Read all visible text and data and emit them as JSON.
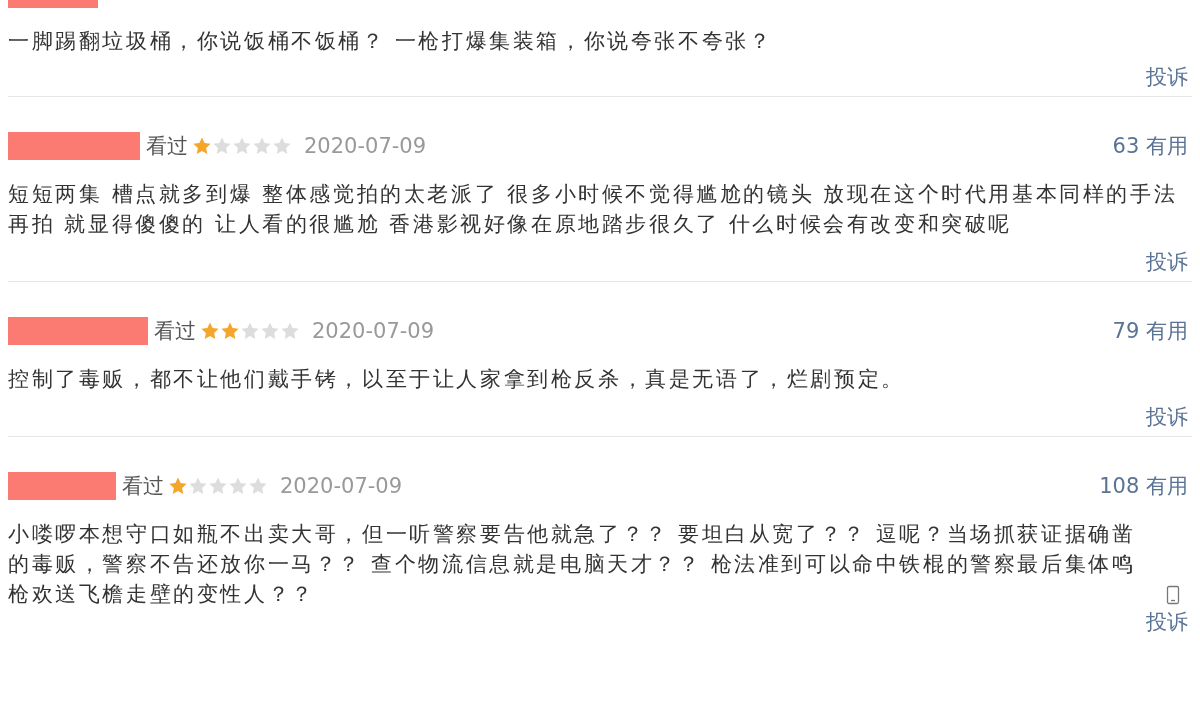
{
  "comments": [
    {
      "text": "一脚踢翻垃圾桶，你说饭桶不饭桶？ 一枪打爆集装箱，你说夸张不夸张？",
      "report": "投诉"
    },
    {
      "status": "看过",
      "stars": 1,
      "date": "2020-07-09",
      "votes": "63 有用",
      "text": "短短两集 槽点就多到爆 整体感觉拍的太老派了 很多小时候不觉得尴尬的镜头 放现在这个时代用基本同样的手法再拍 就显得傻傻的 让人看的很尴尬 香港影视好像在原地踏步很久了 什么时候会有改变和突破呢",
      "report": "投诉"
    },
    {
      "status": "看过",
      "stars": 2,
      "date": "2020-07-09",
      "votes": "79 有用",
      "text": "控制了毒贩，都不让他们戴手铐，以至于让人家拿到枪反杀，真是无语了，烂剧预定。",
      "report": "投诉"
    },
    {
      "status": "看过",
      "stars": 1,
      "date": "2020-07-09",
      "votes": "108 有用",
      "text": "小喽啰本想守口如瓶不出卖大哥，但一听警察要告他就急了？？ 要坦白从宽了？？ 逗呢？当场抓获证据确凿的毒贩，警察不告还放你一马？？ 查个物流信息就是电脑天才？？ 枪法准到可以命中铁棍的警察最后集体鸣枪欢送飞檐走壁的变性人？？",
      "mobile": true,
      "report": "投诉"
    }
  ]
}
